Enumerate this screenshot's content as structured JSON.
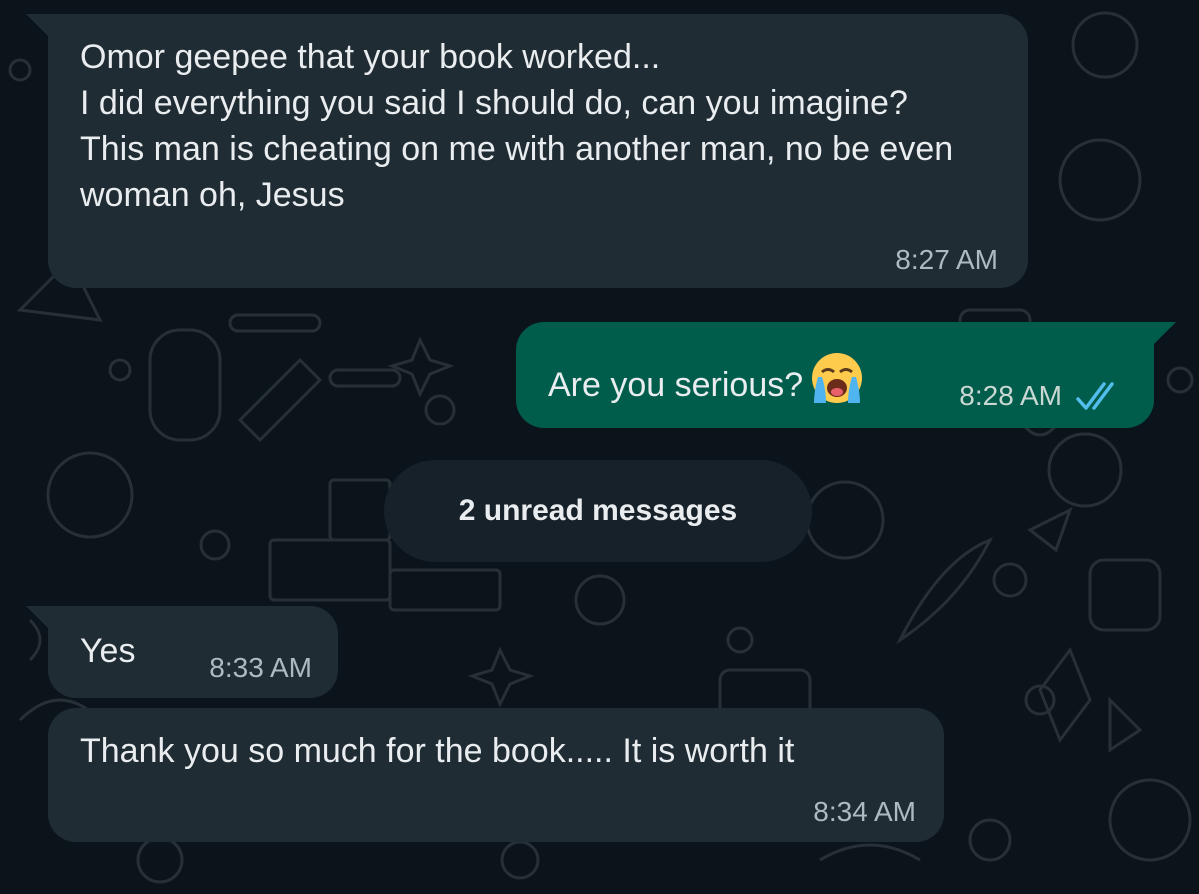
{
  "messages": [
    {
      "direction": "incoming",
      "text": "Omor geepee that your book worked...\nI did everything you said I should do, can you imagine?\nThis man is cheating on me with another man, no be even woman oh, Jesus",
      "time": "8:27 AM"
    },
    {
      "direction": "outgoing",
      "text": "Are you serious?",
      "emoji": "loudly-crying-face-emoji",
      "time": "8:28 AM",
      "status_icon": "double-check-read-icon"
    },
    {
      "direction": "incoming",
      "text": "Yes",
      "time": "8:33 AM"
    },
    {
      "direction": "incoming",
      "text": "Thank you so much for the book..... It is worth it",
      "time": "8:34 AM"
    }
  ],
  "unread_divider": {
    "label": "2 unread messages"
  },
  "colors": {
    "background": "#0b141a",
    "incoming_bubble": "#202c33",
    "outgoing_bubble": "#005c4b",
    "read_ticks": "#53bdeb",
    "doodle": "#2a3439"
  }
}
